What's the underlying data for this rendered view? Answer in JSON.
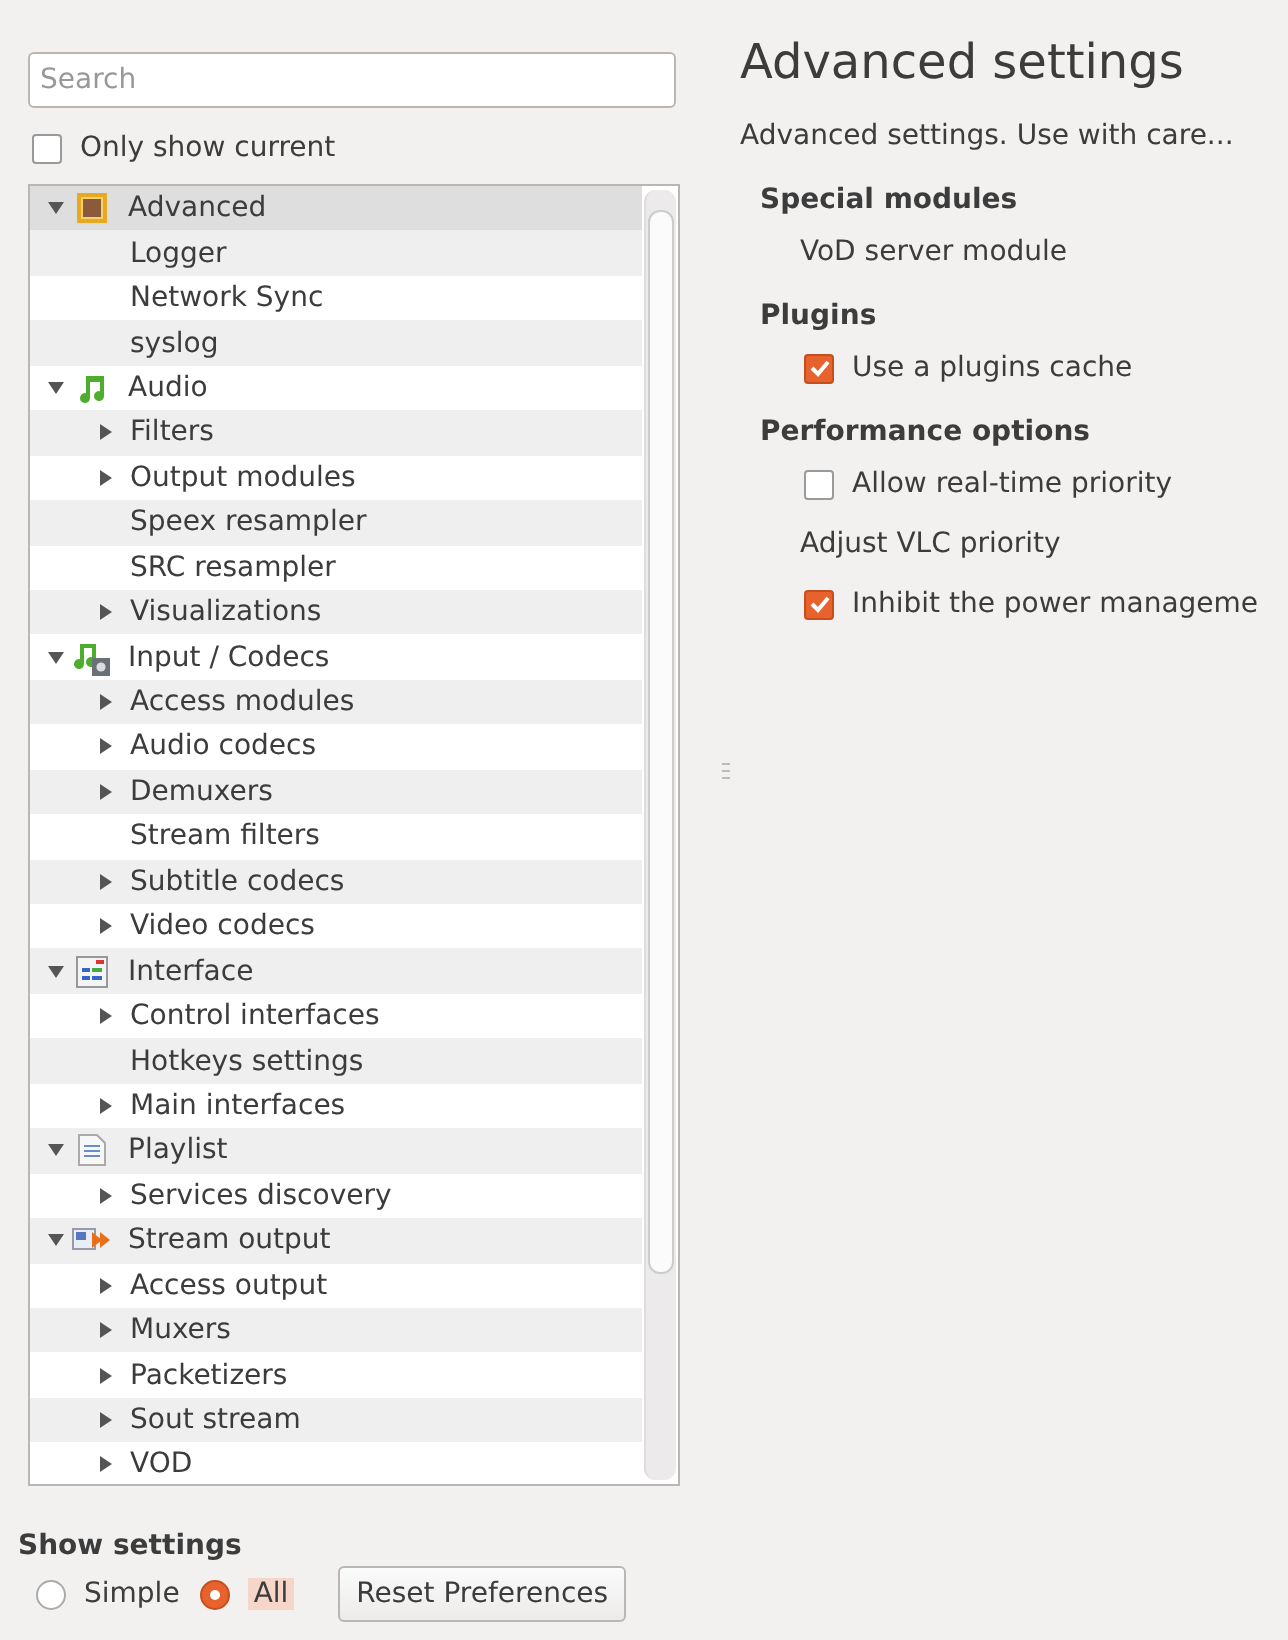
{
  "search": {
    "placeholder": "Search"
  },
  "only_show_current": {
    "label": "Only show current",
    "checked": false
  },
  "tree": [
    {
      "label": "Advanced",
      "expanded": true,
      "selected": true,
      "children": [
        {
          "label": "Logger",
          "kind": "leaf",
          "selected": false
        },
        {
          "label": "Network Sync",
          "kind": "leaf",
          "selected": false
        },
        {
          "label": "syslog",
          "kind": "leaf",
          "selected": false
        }
      ]
    },
    {
      "label": "Audio",
      "expanded": true,
      "selected": false,
      "children": [
        {
          "label": "Filters",
          "kind": "branch",
          "selected": false
        },
        {
          "label": "Output modules",
          "kind": "branch",
          "selected": false
        },
        {
          "label": "Speex resampler",
          "kind": "leaf",
          "selected": false
        },
        {
          "label": "SRC resampler",
          "kind": "leaf",
          "selected": false
        },
        {
          "label": "Visualizations",
          "kind": "branch",
          "selected": false
        }
      ]
    },
    {
      "label": "Input / Codecs",
      "expanded": true,
      "selected": false,
      "children": [
        {
          "label": "Access modules",
          "kind": "branch",
          "selected": false
        },
        {
          "label": "Audio codecs",
          "kind": "branch",
          "selected": false
        },
        {
          "label": "Demuxers",
          "kind": "branch",
          "selected": false
        },
        {
          "label": "Stream filters",
          "kind": "leaf",
          "selected": false
        },
        {
          "label": "Subtitle codecs",
          "kind": "branch",
          "selected": false
        },
        {
          "label": "Video codecs",
          "kind": "branch",
          "selected": false
        }
      ]
    },
    {
      "label": "Interface",
      "expanded": true,
      "selected": false,
      "children": [
        {
          "label": "Control interfaces",
          "kind": "branch",
          "selected": false
        },
        {
          "label": "Hotkeys settings",
          "kind": "leaf",
          "selected": false
        },
        {
          "label": "Main interfaces",
          "kind": "branch",
          "selected": false
        }
      ]
    },
    {
      "label": "Playlist",
      "expanded": true,
      "selected": false,
      "children": [
        {
          "label": "Services discovery",
          "kind": "branch",
          "selected": false
        }
      ]
    },
    {
      "label": "Stream output",
      "expanded": true,
      "selected": false,
      "children": [
        {
          "label": "Access output",
          "kind": "branch",
          "selected": false
        },
        {
          "label": "Muxers",
          "kind": "branch",
          "selected": false
        },
        {
          "label": "Packetizers",
          "kind": "branch",
          "selected": false
        },
        {
          "label": "Sout stream",
          "kind": "branch",
          "selected": false
        },
        {
          "label": "VOD",
          "kind": "branch",
          "selected": false
        }
      ]
    }
  ],
  "show_settings": {
    "title": "Show settings",
    "options": [
      {
        "label": "Simple",
        "selected": false
      },
      {
        "label": "All",
        "selected": true
      }
    ]
  },
  "reset_button": "Reset Preferences",
  "panel": {
    "title": "Advanced settings",
    "description": "Advanced settings. Use with care...",
    "sections": [
      {
        "title": "Special modules",
        "items": [
          {
            "kind": "label",
            "label": "VoD server module"
          }
        ]
      },
      {
        "title": "Plugins",
        "items": [
          {
            "kind": "checkbox",
            "label": "Use a plugins cache",
            "checked": true
          }
        ]
      },
      {
        "title": "Performance options",
        "items": [
          {
            "kind": "checkbox",
            "label": "Allow real-time priority",
            "checked": false
          },
          {
            "kind": "label",
            "label": "Adjust VLC priority"
          },
          {
            "kind": "checkbox",
            "label": "Inhibit the power manageme",
            "checked": true
          }
        ]
      }
    ]
  }
}
